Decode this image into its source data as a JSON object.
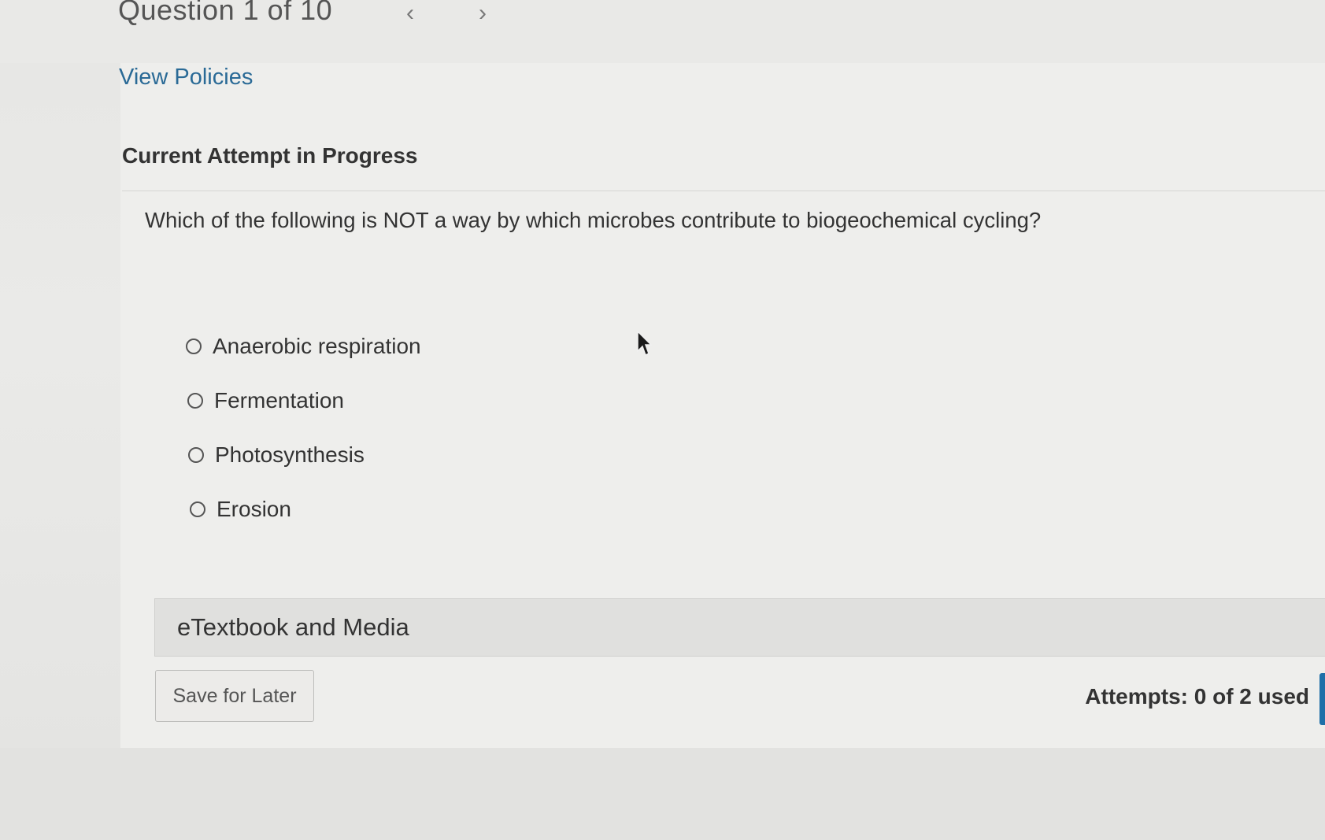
{
  "header": {
    "question_counter": "Question 1 of 10",
    "prev_icon": "chevron-left-icon",
    "next_icon": "chevron-right-icon"
  },
  "links": {
    "view_policies": "View Policies"
  },
  "attempt": {
    "heading": "Current Attempt in Progress"
  },
  "question": {
    "text": "Which of the following is NOT a way by which microbes contribute to biogeochemical cycling?",
    "options": [
      {
        "label": "Anaerobic respiration",
        "selected": false
      },
      {
        "label": "Fermentation",
        "selected": false
      },
      {
        "label": "Photosynthesis",
        "selected": false
      },
      {
        "label": "Erosion",
        "selected": false
      }
    ]
  },
  "media": {
    "label": "eTextbook and Media"
  },
  "footer": {
    "save_label": "Save for Later",
    "attempts_text": "Attempts: 0 of 2 used"
  },
  "colors": {
    "link": "#2a6a96",
    "accent": "#1f6fa8"
  }
}
